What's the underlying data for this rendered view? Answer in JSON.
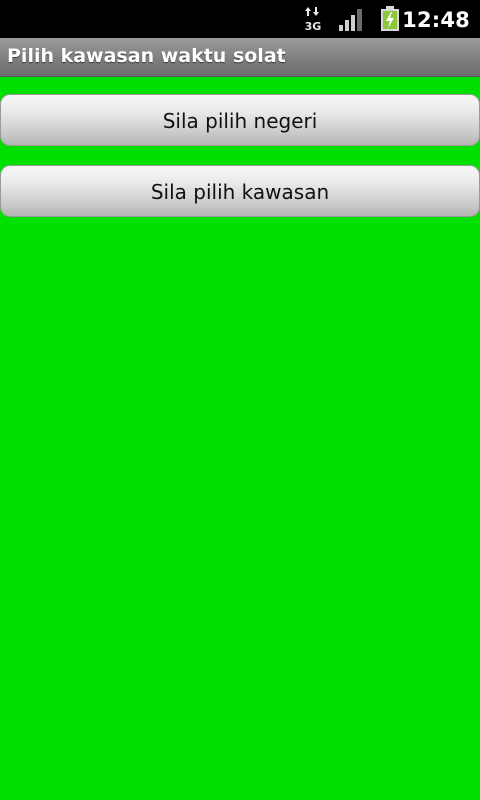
{
  "status_bar": {
    "network_label": "3G",
    "network_icon": "network-3g-icon",
    "signal_icon": "signal-bars-icon",
    "battery_icon": "battery-charging-icon",
    "time": "12:48"
  },
  "title_bar": {
    "title": "Pilih kawasan waktu solat"
  },
  "main": {
    "state_button_label": "Sila pilih negeri",
    "zone_button_label": "Sila pilih kawasan"
  },
  "colors": {
    "background": "#00e000",
    "status_bar": "#000000",
    "title_bar": "#8a8a8a",
    "battery_fill": "#8dc63f"
  }
}
